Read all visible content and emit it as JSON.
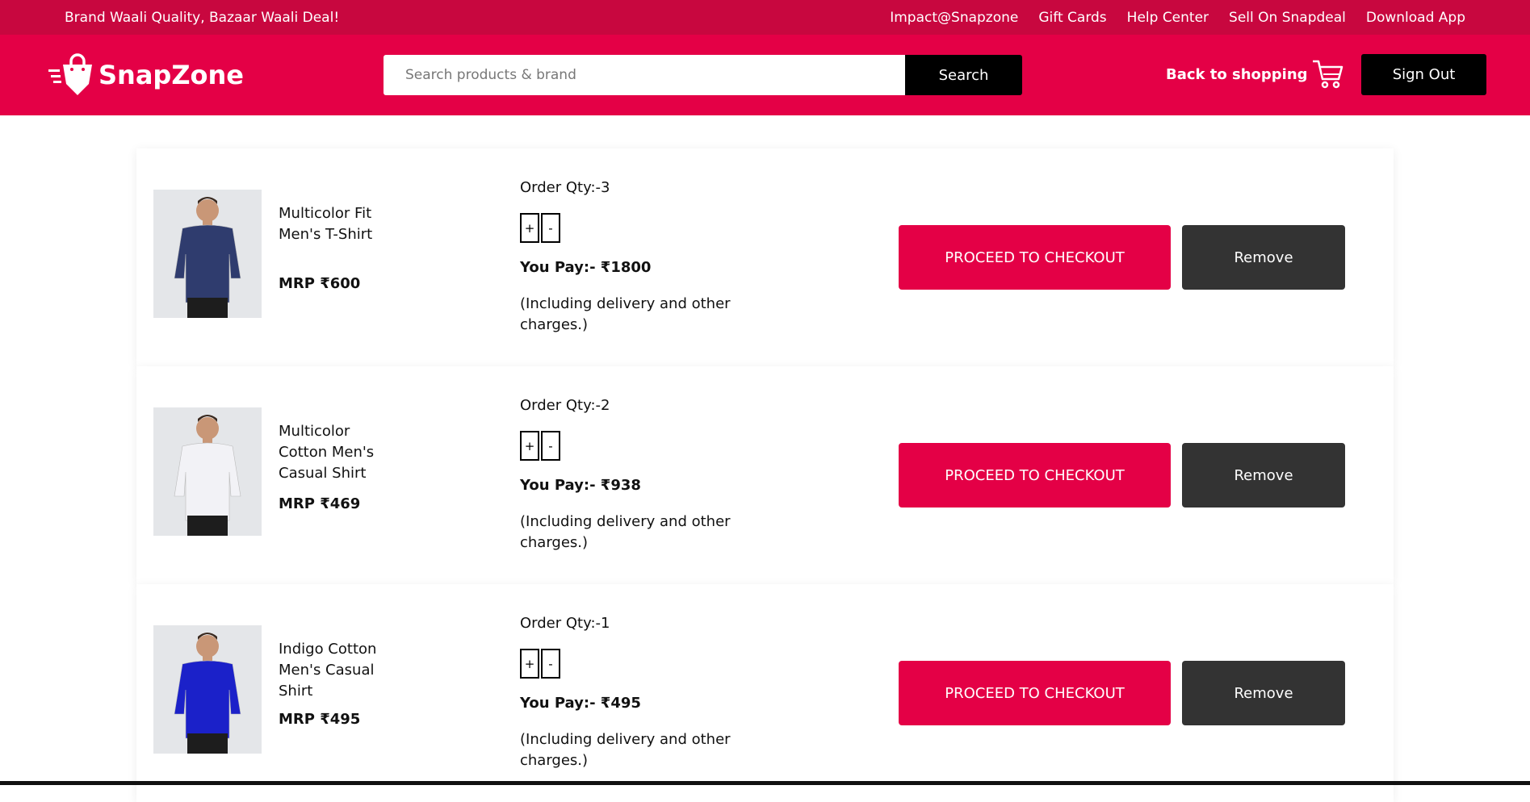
{
  "topbar": {
    "tagline": "Brand Waali Quality, Bazaar Waali Deal!",
    "links": [
      "Impact@Snapzone",
      "Gift Cards",
      "Help Center",
      "Sell On Snapdeal",
      "Download App"
    ]
  },
  "header": {
    "logo_text": "SnapZone",
    "search_placeholder": "Search products & brand",
    "search_button": "Search",
    "back_label": "Back to shopping",
    "signout_label": "Sign Out"
  },
  "cart": [
    {
      "name": "Multicolor Fit Men's T-Shirt",
      "mrp": "MRP ₹600",
      "qty": "Order Qty:-3",
      "pay": "You Pay:- ₹1800",
      "note": "(Including delivery and other charges.)",
      "shirt_color": "#2f3c6e"
    },
    {
      "name": "Multicolor Cotton Men's Casual Shirt",
      "mrp": "MRP ₹469",
      "qty": "Order Qty:-2",
      "pay": "You Pay:- ₹938",
      "note": "(Including delivery and other charges.)",
      "shirt_color": "#f2f2f6"
    },
    {
      "name": "Indigo Cotton Men's Casual Shirt",
      "mrp": "MRP ₹495",
      "qty": "Order Qty:-1",
      "pay": "You Pay:- ₹495",
      "note": "(Including delivery and other charges.)",
      "shirt_color": "#1b21c9"
    }
  ],
  "labels": {
    "plus": "+",
    "minus": "-",
    "checkout": "PROCEED TO CHECKOUT",
    "remove": "Remove"
  },
  "colors": {
    "brand": "#e40046",
    "brand_dark": "#c8073f",
    "dark_button": "#333333"
  },
  "icons": {
    "logo": "shopping-bag-icon",
    "cart": "cart-icon"
  }
}
